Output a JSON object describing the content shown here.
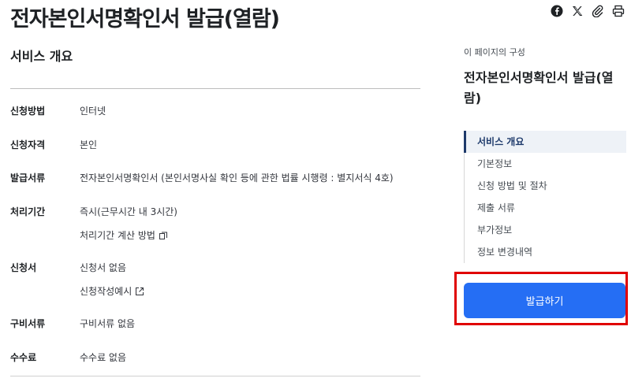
{
  "page": {
    "title": "전자본인서명확인서 발급(열람)"
  },
  "share_bar": {
    "icons": [
      "facebook-icon",
      "x-icon",
      "link-icon",
      "print-icon"
    ]
  },
  "main": {
    "section_title": "서비스 개요",
    "rows": [
      {
        "label": "신청방법",
        "value": "인터넷"
      },
      {
        "label": "신청자격",
        "value": "본인"
      },
      {
        "label": "발급서류",
        "value": "전자본인서명확인서 (본인서명사실 확인 등에 관한 법률 시행령 : 별지서식 4호)"
      },
      {
        "label": "처리기간",
        "value": "즉시(근무시간 내 3시간)",
        "link": "처리기간 계산 방법"
      },
      {
        "label": "신청서",
        "value": "신청서 없음",
        "link": "신청작성예시"
      },
      {
        "label": "구비서류",
        "value": "구비서류 없음"
      },
      {
        "label": "수수료",
        "value": "수수료 없음"
      }
    ]
  },
  "toc": {
    "caption": "이 페이지의 구성",
    "title": "전자본인서명확인서 발급(열람)",
    "items": [
      {
        "label": "서비스 개요",
        "active": true
      },
      {
        "label": "기본정보"
      },
      {
        "label": "신청 방법 및 절차"
      },
      {
        "label": "제출 서류"
      },
      {
        "label": "부가정보"
      },
      {
        "label": "정보 변경내역"
      }
    ]
  },
  "action": {
    "issue_button_label": "발급하기"
  },
  "colors": {
    "primary": "#256ef4",
    "highlight": "#e00000",
    "toc_active": "#1e3a6b"
  }
}
